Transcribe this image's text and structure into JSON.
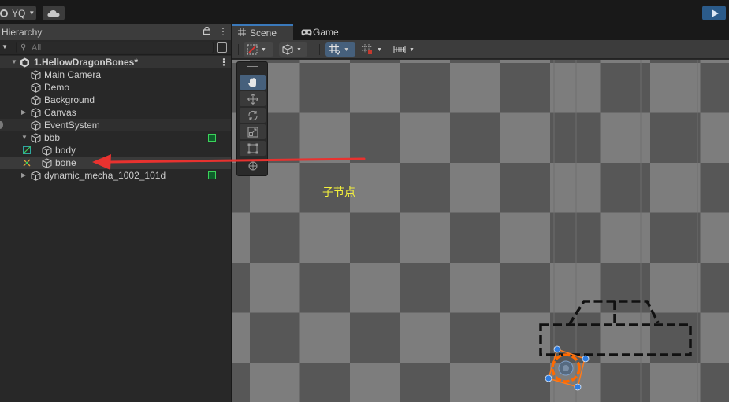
{
  "topbar": {
    "account_label": "YQ",
    "play_color": "#2b5b8a"
  },
  "hierarchy": {
    "title": "Hierarchy",
    "search_placeholder": "All",
    "scene_name": "1.HellowDragonBones*",
    "items": [
      {
        "label": "Main Camera",
        "icon": "gameobject-cube-icon"
      },
      {
        "label": "Demo",
        "icon": "gameobject-cube-icon"
      },
      {
        "label": "Background",
        "icon": "gameobject-cube-icon"
      },
      {
        "label": "Canvas",
        "icon": "gameobject-cube-icon"
      },
      {
        "label": "EventSystem",
        "icon": "gameobject-cube-icon"
      },
      {
        "label": "bbb",
        "icon": "gameobject-cube-icon"
      },
      {
        "label": "body",
        "icon": "gameobject-cube-icon"
      },
      {
        "label": "bone",
        "icon": "gameobject-cube-icon"
      },
      {
        "label": "dynamic_mecha_1002_101d",
        "icon": "gameobject-cube-icon"
      }
    ]
  },
  "scene_view": {
    "tabs": [
      {
        "label": "Scene",
        "icon": "hash-grid-icon"
      },
      {
        "label": "Game",
        "icon": "gamepad-icon"
      }
    ],
    "annotation": "子节点",
    "annotation_color": "#f3f03c",
    "arrow_color": "#e8322f",
    "selection_color": "#ff7a1a",
    "handle_color": "#2f7de1"
  }
}
